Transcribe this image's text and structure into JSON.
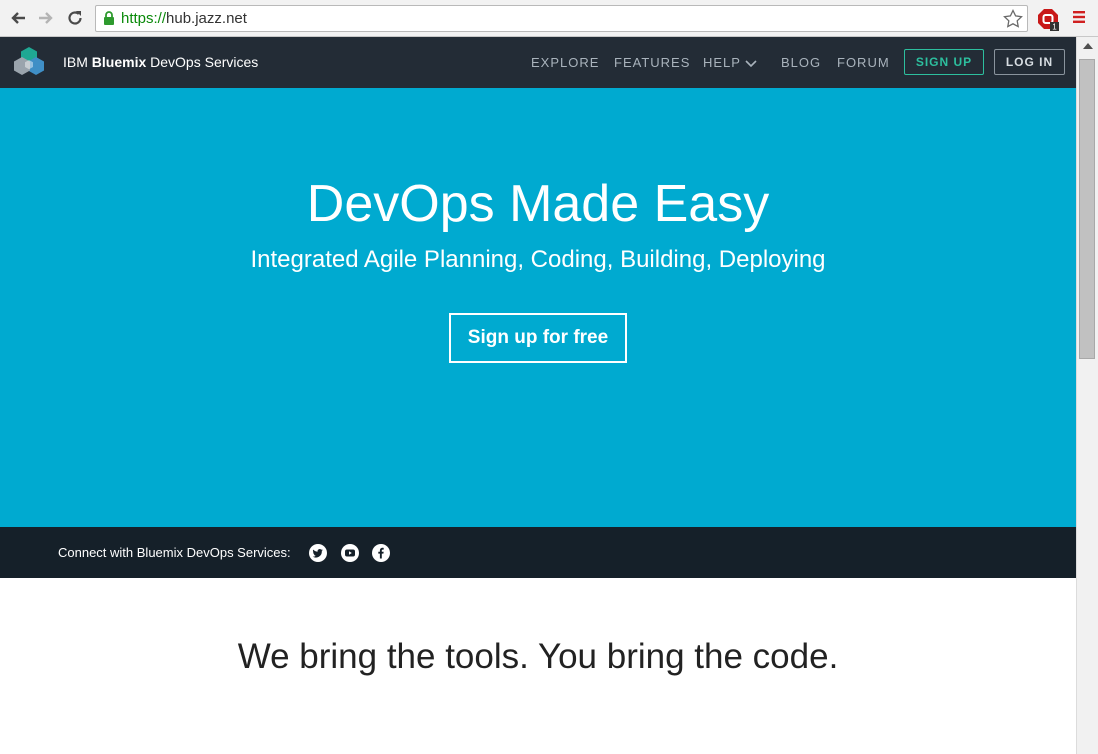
{
  "browser": {
    "url_scheme": "https://",
    "url_host": "hub.jazz.net"
  },
  "header": {
    "brand_prefix": "IBM",
    "brand_bold": "Bluemix",
    "brand_suffix": "DevOps Services",
    "nav": {
      "explore": "EXPLORE",
      "features": "FEATURES",
      "help": "HELP",
      "blog": "BLOG",
      "forum": "FORUM"
    },
    "sign_up": "SIGN UP",
    "log_in": "LOG IN"
  },
  "hero": {
    "title": "DevOps Made Easy",
    "subtitle": "Integrated Agile Planning, Coding, Building, Deploying",
    "cta": "Sign up for free"
  },
  "social": {
    "label": "Connect with Bluemix DevOps Services:",
    "icons": [
      "twitter-icon",
      "youtube-icon",
      "facebook-icon"
    ]
  },
  "content": {
    "tagline": "We bring the tools. You bring the code."
  },
  "colors": {
    "hero_bg": "#00aad0",
    "header_bg": "#232c36",
    "social_bg": "#152029",
    "signup_accent": "#2dbf9e"
  }
}
